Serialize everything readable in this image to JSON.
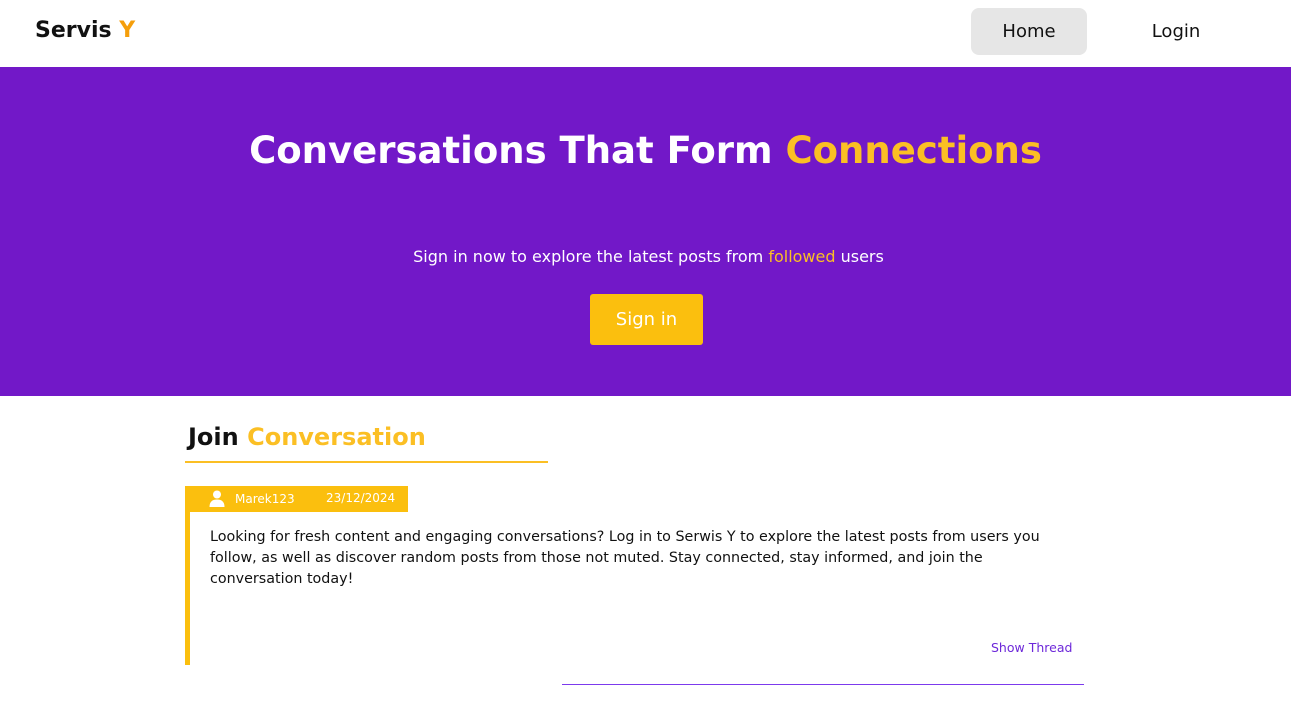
{
  "header": {
    "brand_main": "Servis ",
    "brand_accent": "Y",
    "nav": {
      "home_label": "Home",
      "login_label": "Login"
    }
  },
  "hero": {
    "title_main": "Conversations That Form ",
    "title_accent": "Connections",
    "subtitle_before": "Sign in now to explore the latest posts from ",
    "subtitle_accent": "followed",
    "subtitle_after": " users",
    "signin_label": "Sign in"
  },
  "section": {
    "title_main": "Join ",
    "title_accent": "Conversation"
  },
  "post": {
    "user_icon": "user-icon",
    "username": "Marek123",
    "date": "23/12/2024",
    "body": "Looking for fresh content and engaging conversations? Log in to Serwis Y to explore the latest posts from users you follow, as well as discover random posts from those not muted. Stay connected, stay informed, and join the conversation today!",
    "show_thread_label": "Show Thread"
  },
  "colors": {
    "primary_purple": "#7218c8",
    "accent_yellow": "#fbbf24",
    "button_yellow": "#fbbf0e",
    "brand_orange": "#f59e0b",
    "link_purple": "#6d28d9"
  }
}
